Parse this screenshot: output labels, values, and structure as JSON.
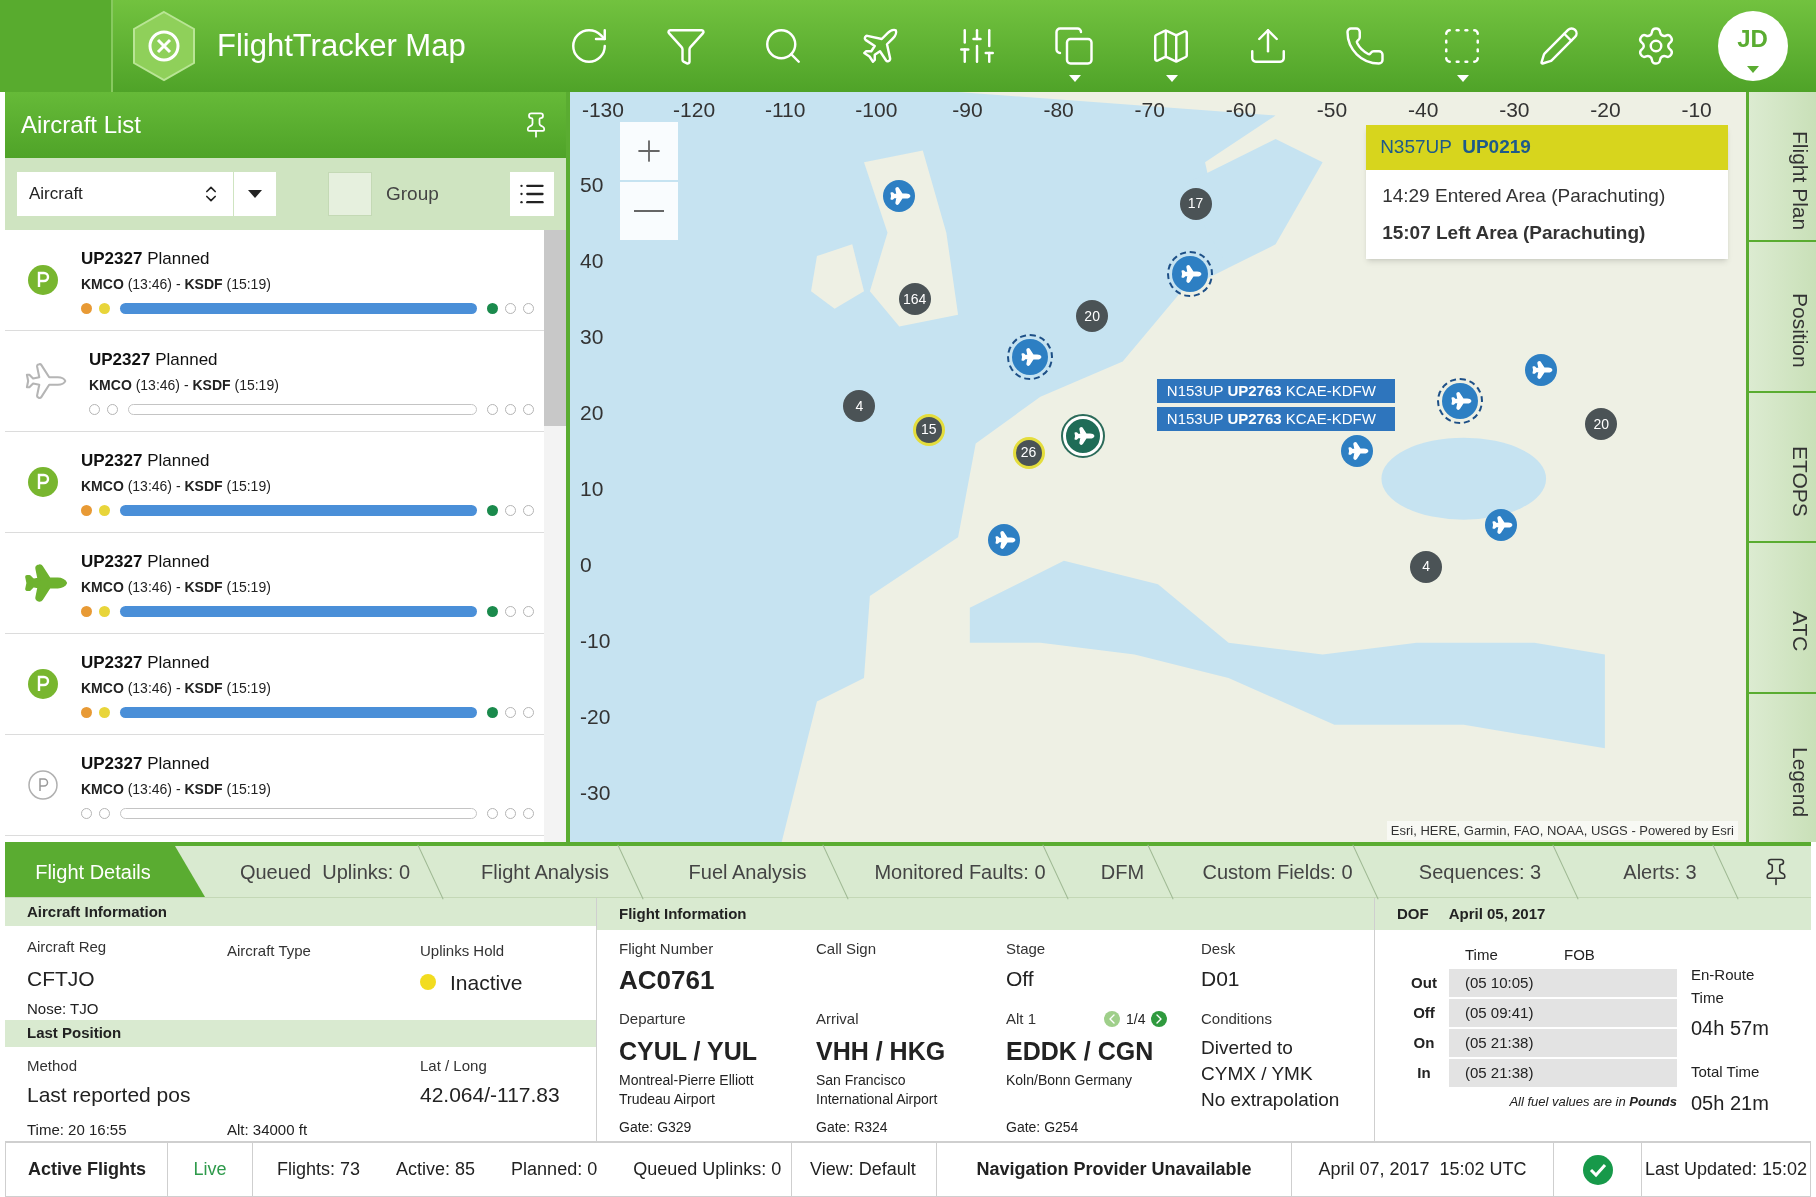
{
  "header": {
    "title": "FlightTracker Map",
    "toolbar": [
      {
        "kind": "refresh",
        "has_menu": false
      },
      {
        "kind": "filter",
        "has_menu": false
      },
      {
        "kind": "search",
        "has_menu": false
      },
      {
        "kind": "plane",
        "has_menu": false
      },
      {
        "kind": "sliders",
        "has_menu": false
      },
      {
        "kind": "layers",
        "has_menu": true
      },
      {
        "kind": "map",
        "has_menu": true
      },
      {
        "kind": "upload",
        "has_menu": false
      },
      {
        "kind": "phone",
        "has_menu": false
      },
      {
        "kind": "select",
        "has_menu": true
      },
      {
        "kind": "pencil",
        "has_menu": false
      },
      {
        "kind": "settings",
        "has_menu": false
      }
    ],
    "avatar": {
      "initials": "JD",
      "has_menu": true
    }
  },
  "aircraft_list": {
    "title": "Aircraft List",
    "select": "Aircraft",
    "group": {
      "label": "Group",
      "checked": false
    },
    "items": [
      {
        "kind": "badge",
        "title": "**UP2327** Planned",
        "route": "**KMCO** (13:46) - **KSDF** (15:19)",
        "active": true,
        "start_dots": [
          {
            "filled": true,
            "color": "#e89a35"
          },
          {
            "filled": true,
            "color": "#e8d53a"
          }
        ],
        "end_dots": [
          {
            "filled": true,
            "color": "#1a8a4c"
          },
          {
            "filled": false
          },
          {
            "filled": false
          }
        ]
      },
      {
        "kind": "plane-outline",
        "title": "**UP2327** Planned",
        "route": "**KMCO** (13:46) - **KSDF** (15:19)",
        "active": false,
        "start_dots": [
          {
            "filled": false
          },
          {
            "filled": false
          }
        ],
        "end_dots": [
          {
            "filled": false
          },
          {
            "filled": false
          },
          {
            "filled": false
          }
        ]
      },
      {
        "kind": "badge",
        "title": "**UP2327** Planned",
        "route": "**KMCO** (13:46) - **KSDF** (15:19)",
        "active": true,
        "start_dots": [
          {
            "filled": true,
            "color": "#e89a35"
          },
          {
            "filled": true,
            "color": "#e8d53a"
          }
        ],
        "end_dots": [
          {
            "filled": true,
            "color": "#1a8a4c"
          },
          {
            "filled": false
          },
          {
            "filled": false
          }
        ]
      },
      {
        "kind": "plane",
        "title": "**UP2327** Planned",
        "route": "**KMCO** (13:46) - **KSDF** (15:19)",
        "active": true,
        "start_dots": [
          {
            "filled": true,
            "color": "#e89a35"
          },
          {
            "filled": true,
            "color": "#e8d53a"
          }
        ],
        "end_dots": [
          {
            "filled": true,
            "color": "#1a8a4c"
          },
          {
            "filled": false
          },
          {
            "filled": false
          }
        ]
      },
      {
        "kind": "badge",
        "title": "**UP2327** Planned",
        "route": "**KMCO** (13:46) - **KSDF** (15:19)",
        "active": true,
        "start_dots": [
          {
            "filled": true,
            "color": "#e89a35"
          },
          {
            "filled": true,
            "color": "#e8d53a"
          }
        ],
        "end_dots": [
          {
            "filled": true,
            "color": "#1a8a4c"
          },
          {
            "filled": false
          },
          {
            "filled": false
          }
        ]
      },
      {
        "kind": "badge-outline",
        "title": "**UP2327** Planned",
        "route": "**KMCO** (13:46) - **KSDF** (15:19)",
        "active": false,
        "start_dots": [
          {
            "filled": false
          },
          {
            "filled": false
          }
        ],
        "end_dots": [
          {
            "filled": false
          },
          {
            "filled": false
          },
          {
            "filled": false
          }
        ]
      }
    ]
  },
  "map": {
    "x_ticks": [
      "-130",
      "-120",
      "-110",
      "-100",
      "-90",
      "-80",
      "-70",
      "-60",
      "-50",
      "-40",
      "-30",
      "-20",
      "-10"
    ],
    "y_ticks": [
      "50",
      "40",
      "30",
      "20",
      "10",
      "0",
      "-10",
      "-20",
      "-30"
    ],
    "clusters": [
      {
        "count": "17",
        "ringed": false
      },
      {
        "count": "164",
        "ringed": false
      },
      {
        "count": "20",
        "ringed": false
      },
      {
        "count": "4",
        "ringed": false
      },
      {
        "count": "15",
        "ringed": true
      },
      {
        "count": "26",
        "ringed": true
      },
      {
        "count": "20",
        "ringed": false
      },
      {
        "count": "4",
        "ringed": false
      }
    ],
    "planes": [
      {
        "kind": "plain"
      },
      {
        "kind": "dashed"
      },
      {
        "kind": "dashed"
      },
      {
        "kind": "selected"
      },
      {
        "kind": "plain"
      },
      {
        "kind": "dashed"
      },
      {
        "kind": "plain"
      },
      {
        "kind": "plain"
      },
      {
        "kind": "plain"
      }
    ],
    "flight_labels": [
      "N153UP **UP2763** KCAE-KDFW",
      "N153UP **UP2763** KCAE-KDFW"
    ],
    "tooltip": {
      "title": "N357UP  **UP0219**",
      "events": [
        {
          "text": "14:29 Entered Area (Parachuting)",
          "emphasis": false
        },
        {
          "text": "15:07 Left Area (Parachuting)",
          "emphasis": true
        }
      ]
    },
    "attribution": "Esri, HERE, Garmin, FAO, NOAA, USGS - Powered by Esri"
  },
  "side_tabs": [
    "Flight Plan",
    "Position",
    "ETOPS",
    "ATC",
    "Legend"
  ],
  "detail_tabs": [
    {
      "label": "Flight Details",
      "selected": true
    },
    {
      "label": "Queued  Uplinks: 0",
      "selected": false
    },
    {
      "label": "Flight Analysis",
      "selected": false
    },
    {
      "label": "Fuel Analysis",
      "selected": false
    },
    {
      "label": "Monitored Faults: 0",
      "selected": false
    },
    {
      "label": "DFM",
      "selected": false
    },
    {
      "label": "Custom Fields: 0",
      "selected": false
    },
    {
      "label": "Sequences: 3",
      "selected": false
    },
    {
      "label": "Alerts: 3",
      "selected": false
    }
  ],
  "aircraft_information": {
    "title": "Aircraft Information",
    "reg_label": "Aircraft Reg",
    "reg": "CFTJO",
    "type_label": "Aircraft Type",
    "uplinks_label": "Uplinks Hold",
    "uplinks": {
      "text": "Inactive",
      "color": "#f2dc1f"
    },
    "nose": "Nose:  TJO"
  },
  "last_position": {
    "title": "Last Position",
    "method_label": "Method",
    "method": "Last reported pos",
    "latlong_label": "Lat / Long",
    "latlong": "42.064/-117.83",
    "time": "Time:  20 16:55",
    "alt": "Alt:  34000 ft"
  },
  "flight_information": {
    "title": "Flight Information",
    "flight_number_label": "Flight Number",
    "flight_number": "AC0761",
    "call_sign_label": "Call Sign",
    "stage_label": "Stage",
    "stage": "Off",
    "desk_label": "Desk",
    "desk": "D01",
    "airports": [
      {
        "label": "Departure",
        "code": "CYUL / YUL",
        "name": [
          "Montreal-Pierre Elliott",
          "Trudeau Airport"
        ],
        "gate": "Gate: G329"
      },
      {
        "label": "Arrival",
        "code": "VHH / HKG",
        "name": [
          "San Francisco",
          "International Airport"
        ],
        "gate": "Gate: R324"
      },
      {
        "label": "Alt 1",
        "pager": "1/4",
        "code": "EDDK / CGN",
        "name": [
          "Koln/Bonn Germany"
        ],
        "gate": "Gate: G254"
      }
    ],
    "conditions_label": "Conditions",
    "conditions": [
      "Diverted to",
      "CYMX / YMK",
      "No extrapolation"
    ]
  },
  "dof": {
    "label": "DOF",
    "date": "April 05, 2017",
    "columns": [
      "Time",
      "FOB"
    ],
    "rows": [
      {
        "label": "Out",
        "time": "(05 10:05)"
      },
      {
        "label": "Off",
        "time": "(05 09:41)"
      },
      {
        "label": "On",
        "time": "(05 21:38)"
      },
      {
        "label": "In",
        "time": "(05 21:38)"
      }
    ],
    "enroute_label": "En-Route Time",
    "enroute": "04h 57m",
    "total_label": "Total Time",
    "total": "05h 21m",
    "note": "All fuel values are in **Pounds**"
  },
  "status_bar": {
    "title": "Active Flights",
    "live": "Live",
    "counts": [
      "Flights: 73",
      "Active: 85",
      "Planned: 0",
      "Queued Uplinks: 0"
    ],
    "view": "View: Default",
    "navigation": "Navigation Provider Unavailable",
    "datetime": "April 07, 2017  15:02 UTC",
    "ok": true,
    "updated": "Last Updated: 15:02"
  }
}
